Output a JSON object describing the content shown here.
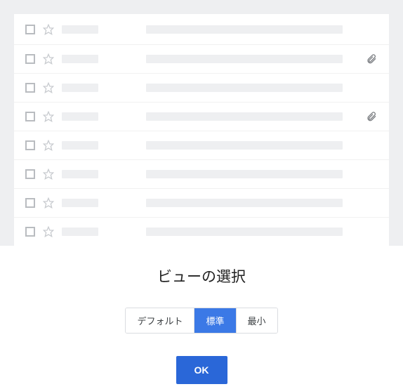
{
  "rows": [
    {
      "has_attachment": false
    },
    {
      "has_attachment": true
    },
    {
      "has_attachment": false
    },
    {
      "has_attachment": true
    },
    {
      "has_attachment": false
    },
    {
      "has_attachment": false
    },
    {
      "has_attachment": false
    },
    {
      "has_attachment": false
    }
  ],
  "dialog": {
    "title": "ビューの選択",
    "options": {
      "default": "デフォルト",
      "standard": "標準",
      "compact": "最小"
    },
    "selected": "standard",
    "ok": "OK"
  }
}
